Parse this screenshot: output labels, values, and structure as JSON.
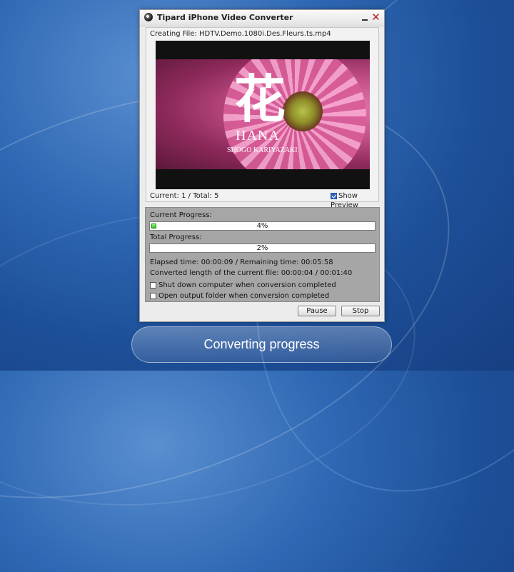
{
  "window": {
    "title": "Tipard iPhone Video Converter",
    "close_glyph": "✕"
  },
  "preview": {
    "creating_file": "Creating File: HDTV.Demo.1080i.Des.Fleurs.ts.mp4",
    "video_title_kanji": "花",
    "video_title": "HANA",
    "video_artist": "SHOGO KARIYAZAKI",
    "current_total": "Current: 1 / Total: 5",
    "show_preview_label": "Show Preview",
    "show_preview_checked": true
  },
  "progress": {
    "current_label": "Current Progress:",
    "current_percent": 4,
    "current_text": "4%",
    "total_label": "Total Progress:",
    "total_percent": 2,
    "total_text": "2%",
    "elapsed_text": "Elapsed time: 00:00:09 / Remaining time: 00:05:58",
    "converted_text": "Converted length of the current file: 00:00:04 / 00:01:40",
    "shutdown_label": "Shut down computer when conversion completed",
    "shutdown_checked": false,
    "open_folder_label": "Open output folder when conversion completed",
    "open_folder_checked": false
  },
  "buttons": {
    "pause": "Pause",
    "stop": "Stop"
  },
  "caption": "Converting progress",
  "icons": {
    "app": "film-reel-icon",
    "minimize": "minimize-icon",
    "close": "close-icon",
    "checkbox_checked": "checkbox-checked-icon"
  },
  "colors": {
    "progress_fill": "#2ec21e",
    "checkbox_checked": "#2f69c6",
    "close": "#bb2222"
  }
}
